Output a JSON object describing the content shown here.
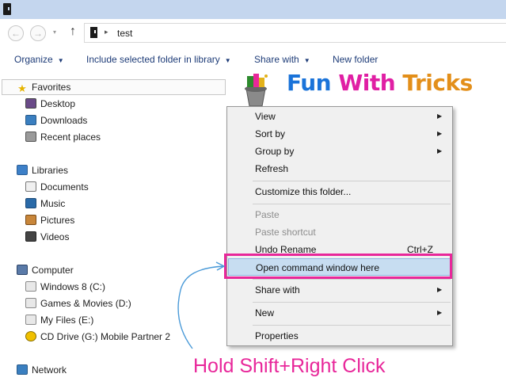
{
  "address": {
    "back_glyph": "←",
    "forward_glyph": "→",
    "dropdown_glyph": "▾",
    "up_glyph": "↑",
    "separator_glyph": "▸",
    "path": "test"
  },
  "toolbar": {
    "organize": "Organize",
    "include": "Include selected folder in library",
    "share": "Share with",
    "new_folder": "New folder",
    "caret": "▼"
  },
  "nav": {
    "favorites": {
      "label": "Favorites",
      "items": [
        "Desktop",
        "Downloads",
        "Recent places"
      ]
    },
    "libraries": {
      "label": "Libraries",
      "items": [
        "Documents",
        "Music",
        "Pictures",
        "Videos"
      ]
    },
    "computer": {
      "label": "Computer",
      "items": [
        "Windows 8 (C:)",
        "Games & Movies (D:)",
        "My Files (E:)",
        "CD Drive (G:) Mobile Partner 2"
      ]
    },
    "network": {
      "label": "Network"
    }
  },
  "logo": {
    "fun": "Fun",
    "with": "With",
    "tricks": "Tricks"
  },
  "context_menu": {
    "arrow_glyph": "▶",
    "view": "View",
    "sort_by": "Sort by",
    "group_by": "Group by",
    "refresh": "Refresh",
    "customize": "Customize this folder...",
    "paste": "Paste",
    "paste_shortcut": "Paste shortcut",
    "undo_rename": "Undo Rename",
    "undo_shortcut": "Ctrl+Z",
    "open_command": "Open command window here",
    "share_with": "Share with",
    "new": "New",
    "properties": "Properties"
  },
  "annotation": {
    "text": "Hold Shift+Right Click"
  },
  "colors": {
    "highlight": "#e8279a",
    "menu_hover": "#c7ddf1",
    "link_blue": "#1e3c78",
    "titlebar": "#c4d6ee"
  }
}
